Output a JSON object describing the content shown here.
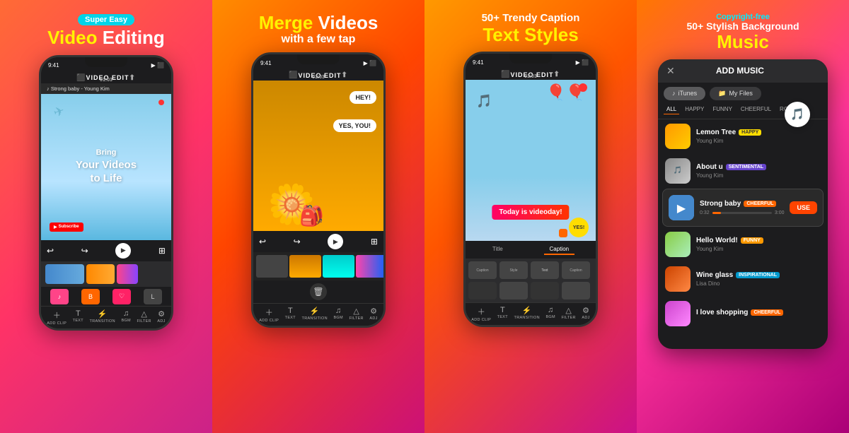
{
  "panels": [
    {
      "id": "panel1",
      "badge": "Super Easy",
      "heading1": "Video",
      "heading1_suffix": " Editing",
      "heading2": null,
      "phone": {
        "title": "VIDEO EDIT",
        "timer": "01:03",
        "music": "♪ Strong baby - Young Kim",
        "canvas_line1": "Bring",
        "canvas_line2": "Your Videos",
        "canvas_line3": "to Life",
        "subscribe": "Subscribe"
      },
      "toolbar": [
        "ADD CLIP",
        "TEXT",
        "TRANSITION",
        "BGM",
        "FILTER",
        "ADJ"
      ]
    },
    {
      "id": "panel2",
      "badge": null,
      "heading1": "Merge",
      "heading1_suffix": " Videos",
      "heading2": "with a few tap",
      "phone": {
        "title": "VIDEO EDIT",
        "timer": "01:03"
      }
    },
    {
      "id": "panel3",
      "badge": null,
      "heading1": "50+ Trendy Caption",
      "heading2": "Text Styles",
      "phone": {
        "title": "VIDEO EDIT",
        "timer": "01:03",
        "caption_text": "Today is videoday!",
        "tabs": [
          "Title",
          "Caption"
        ]
      }
    },
    {
      "id": "panel4",
      "badge": "Copyright-free",
      "heading1": "50+ Stylish Background",
      "heading2": "Music",
      "music_panel": {
        "title": "ADD MUSIC",
        "sources": [
          "iTunes",
          "My Files"
        ],
        "genres": [
          "ALL",
          "HAPPY",
          "FUNNY",
          "CHEERFUL",
          "ROM..."
        ],
        "tracks": [
          {
            "name": "Lemon Tree",
            "tag": "HAPPY",
            "tag_class": "tag-happy",
            "artist": "Young Kim",
            "thumb_class": "thumb-lemon"
          },
          {
            "name": "About u",
            "tag": "SENTIMENTAL",
            "tag_class": "tag-sentimental",
            "artist": "Young Kim",
            "thumb_class": "thumb-about"
          },
          {
            "name": "Strong baby",
            "tag": "CHEERFUL",
            "tag_class": "tag-cheerful",
            "artist": "",
            "thumb_class": "thumb-strong",
            "highlighted": true,
            "time_current": "0:32",
            "time_total": "3:00"
          },
          {
            "name": "Hello World!",
            "tag": "FUNNY",
            "tag_class": "tag-funny",
            "artist": "Young Kim",
            "thumb_class": "thumb-hello"
          },
          {
            "name": "Wine glass",
            "tag": "INSPIRATIONAL",
            "tag_class": "tag-inspirational",
            "artist": "Lisa Dino",
            "thumb_class": "thumb-wine"
          },
          {
            "name": "I love shopping",
            "tag": "CHEERFUL",
            "tag_class": "tag-cheerful",
            "artist": "",
            "thumb_class": "thumb-shopping"
          }
        ]
      }
    }
  ]
}
